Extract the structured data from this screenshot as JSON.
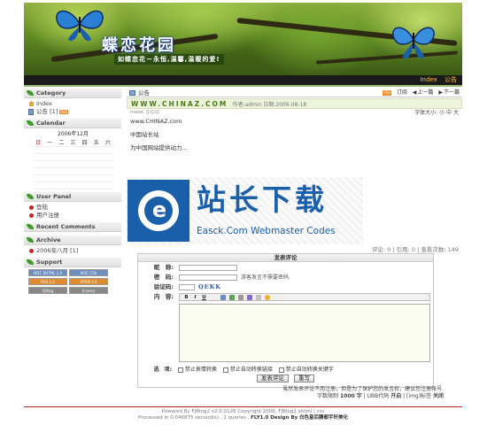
{
  "banner": {
    "title": "蝶恋花园",
    "slogan": "如蝶恋花－永恒,温馨,温暖的爱!"
  },
  "nav": {
    "items": [
      "Index",
      "公告"
    ]
  },
  "sidebar": {
    "category": {
      "heading": "Category",
      "items": [
        {
          "label": "Index",
          "icon": "home-icon"
        },
        {
          "label": "公告 [1]",
          "icon": "folder-icon",
          "rss": "RSS"
        }
      ]
    },
    "calendar": {
      "heading": "Calendar",
      "month": "2006年12月",
      "weekdays": [
        "日",
        "一",
        "二",
        "三",
        "四",
        "五",
        "六"
      ]
    },
    "user_panel": {
      "heading": "User Panel",
      "items": [
        "登陆",
        "用户注册"
      ]
    },
    "recent_comments": {
      "heading": "Recent Comments"
    },
    "archive": {
      "heading": "Archive",
      "items": [
        "2006年八月 [1]"
      ]
    },
    "support": {
      "heading": "Support",
      "badges": [
        "W3C XHTML 1.0",
        "W3C CSS",
        "RSS 2.0",
        "ATOM 1.0",
        "FJBlog",
        "license"
      ]
    }
  },
  "main": {
    "header": {
      "label": "公告",
      "rss": "RSS",
      "subscribe": "订阅",
      "prev": "上一篇",
      "next": "下一篇"
    },
    "post": {
      "title": "WWW.CHINAZ.COM",
      "author_label": "作者:",
      "author": "admin",
      "date_label": "日期:",
      "date": "2006-08-18",
      "weather": "mood: ☺☺☺",
      "font_size_label": "字体大小:",
      "font_sizes": [
        "小",
        "中",
        "大"
      ],
      "body": [
        "www.CHINAZ.com",
        "中国站长站",
        "为中国网站提供动力..."
      ],
      "stats": "评论: 0 | 引用: 0 | 查看次数: 149"
    }
  },
  "watermark": {
    "cn": "站长下载",
    "en": "Easck.Com Webmaster Codes"
  },
  "comment_form": {
    "title": "发表评论",
    "nickname_label": "昵　称:",
    "password_label": "密　码:",
    "password_hint": "游客发言不需要密码.",
    "captcha_label": "验证码:",
    "captcha_value": "QEKK",
    "content_label": "内　容:",
    "toolbar": [
      "B",
      "I",
      "U"
    ],
    "options_label": "选　项:",
    "options": [
      "禁止表情转换",
      "禁止自动转换链接",
      "禁止自动转换关键字"
    ],
    "submit": "发表评论",
    "reset": "重写",
    "note1": "虽然发表评论不用注册，但是为了保护您的发言权，建议您注册帐号.",
    "note2_prefix": "字数限制",
    "note2_chars": "1000 字",
    "note2_ubb": "| UBB代码",
    "note2_on": "开启",
    "note2_img": "| [img]标签",
    "note2_off": "关闭"
  },
  "footer": {
    "line1": "Powered By FJBlog2 v2.0.0126 Copyright 2006, FJBlog2 xhtml | css",
    "line2_a": "Processed in 0.046875 second(s) , 2 queries .",
    "line2_b": "FLY1.0 Design By",
    "line2_c": "白色皇后腰都宇轩美化"
  }
}
